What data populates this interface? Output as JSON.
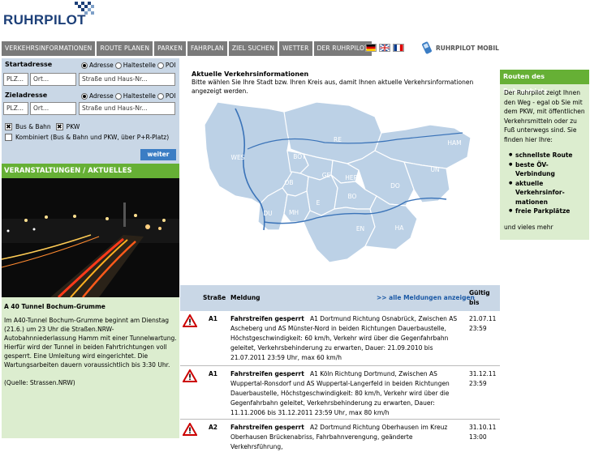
{
  "logo": {
    "text": "RUHRPILOT"
  },
  "nav": [
    "VERKEHRSINFORMATIONEN",
    "ROUTE PLANEN",
    "PARKEN",
    "FAHRPLAN",
    "ZIEL SUCHEN",
    "WETTER",
    "DER RUHRPILOT"
  ],
  "mobile_label": "RUHRPILOT MOBIL",
  "form": {
    "start_label": "Startadresse",
    "ziel_label": "Zieladresse",
    "radio_adresse": "Adresse",
    "radio_haltestelle": "Haltestelle",
    "radio_poi": "POI",
    "plz_placeholder": "PLZ...",
    "ort_placeholder": "Ort...",
    "strasse_placeholder": "Straße und Haus-Nr...",
    "opt_bus": "Bus & Bahn",
    "opt_pkw": "PKW",
    "opt_kombiniert": "Kombiniert (Bus & Bahn und PKW, über P+R-Platz)",
    "weiter": "weiter"
  },
  "events": {
    "header": "VERANSTALTUNGEN / AKTUELLES",
    "title": "A 40 Tunnel Bochum-Grumme",
    "body": "Im A40-Tunnel Bochum-Grumme beginnt am Dienstag (21.6.) um 23 Uhr die Straßen.NRW-Autobahnniederlassung Hamm mit einer Tunnelwartung. Hierfür wird der Tunnel in beiden Fahrtrichtungen voll gesperrt. Eine Umleitung wird eingerichtet. Die Wartungsarbeiten dauern voraussichtlich bis 3:30 Uhr.",
    "source": "(Quelle: Strassen.NRW)"
  },
  "center": {
    "title": "Aktuelle Verkehrsinformationen",
    "subtitle": "Bitte wählen Sie Ihre Stadt bzw. Ihren Kreis aus, damit Ihnen aktuelle Verkehrsinformationen angezeigt werden."
  },
  "map_regions": [
    "RE",
    "HAM",
    "WES",
    "BOT",
    "GE",
    "HER",
    "UN",
    "DO",
    "OB",
    "E",
    "BO",
    "DU",
    "MH",
    "EN",
    "HA"
  ],
  "table": {
    "col_strasse": "Straße",
    "col_meldung": "Meldung",
    "all_link": ">> alle Meldungen anzeigen",
    "col_gueltig": "Gültig bis",
    "rows": [
      {
        "strasse": "A1",
        "title": "Fahrstreifen gesperrt",
        "text": "A1 Dortmund Richtung Osnabrück, Zwischen AS Ascheberg und AS Münster-Nord in beiden Richtungen Dauerbaustelle, Höchstgeschwindigkeit: 60 km/h, Verkehr wird über die Gegenfahrbahn geleitet, Verkehrsbehinderung zu erwarten, Dauer: 21.09.2010 bis 21.07.2011 23:59 Uhr, max 60 km/h",
        "date": "21.07.11",
        "time": "23:59"
      },
      {
        "strasse": "A1",
        "title": "Fahrstreifen gesperrt",
        "text": "A1 Köln Richtung Dortmund, Zwischen AS Wuppertal-Ronsdorf und AS Wuppertal-Langerfeld in beiden Richtungen Dauerbaustelle, Höchstgeschwindigkeit: 80 km/h, Verkehr wird über die Gegenfahrbahn geleitet, Verkehrsbehinderung zu erwarten, Dauer: 11.11.2006 bis 31.12.2011 23:59 Uhr, max 80 km/h",
        "date": "31.12.11",
        "time": "23:59"
      },
      {
        "strasse": "A2",
        "title": "Fahrstreifen gesperrt",
        "text": "A2 Dortmund Richtung Oberhausen im Kreuz Oberhausen Brückenabriss, Fahrbahnverengung, geänderte Verkehrsführung,",
        "date": "31.10.11",
        "time": "13:00"
      }
    ]
  },
  "right": {
    "header": "Routen des Ruhrgebiets",
    "intro": "Der Ruhrpilot zeigt Ihnen den Weg - egal ob Sie mit dem PKW, mit öffentlichen Verkehrsmitteln oder zu Fuß unterwegs sind. Sie finden hier Ihre:",
    "items": [
      "schnellste Route",
      "beste ÖV-Verbindung",
      "aktuelle Verkehrsinfor-mationen",
      "freie Parkplätze"
    ],
    "outro": "und vieles mehr"
  },
  "colors": {
    "brand": "#1c3f78",
    "green": "#66b035",
    "blue_light": "#c9d7e6",
    "map": "#bcd1e6"
  }
}
